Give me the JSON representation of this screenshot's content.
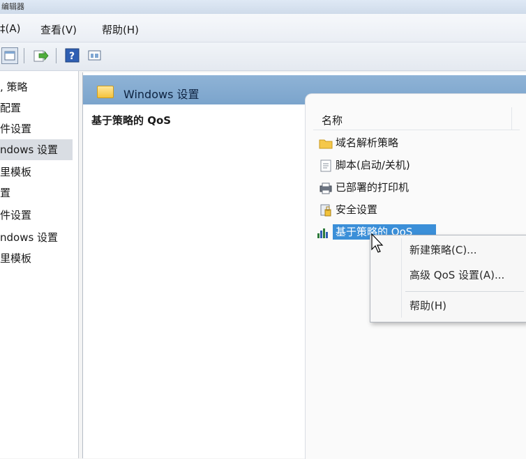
{
  "window": {
    "title": "编辑器"
  },
  "menu": {
    "file": "‡(A)",
    "view": "查看(V)",
    "help": "帮助(H)"
  },
  "toolbar": {
    "items": [
      "back-button",
      "export-button",
      "help-button",
      "view-button"
    ]
  },
  "tree": {
    "items": [
      {
        "label": ", 策略"
      },
      {
        "label": "配置"
      },
      {
        "label": "件设置"
      },
      {
        "label": "ndows 设置",
        "selected": true
      },
      {
        "label": "里模板"
      },
      {
        "label": "置"
      },
      {
        "label": "件设置"
      },
      {
        "label": "ndows 设置"
      },
      {
        "label": "里模板"
      }
    ]
  },
  "detail": {
    "header_title": "Windows 设置",
    "description_title": "基于策略的 QoS",
    "column_name": "名称",
    "items": [
      {
        "label": "域名解析策略",
        "icon": "folder-icon"
      },
      {
        "label": "脚本(启动/关机)",
        "icon": "script-icon"
      },
      {
        "label": "已部署的打印机",
        "icon": "printer-icon"
      },
      {
        "label": "安全设置",
        "icon": "security-icon"
      },
      {
        "label": "基于策略的 QoS",
        "icon": "qos-chart-icon",
        "selected": true
      }
    ]
  },
  "context_menu": {
    "items": [
      "新建策略(C)...",
      "高级 QoS 设置(A)...",
      "帮助(H)"
    ]
  },
  "colors": {
    "header_band": "#8fb3d6",
    "selection": "#3b8fd8"
  }
}
